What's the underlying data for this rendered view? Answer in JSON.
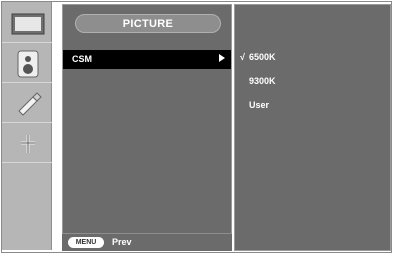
{
  "header": {
    "title": "PICTURE"
  },
  "menu": {
    "items": [
      {
        "label": "CSM"
      }
    ]
  },
  "submenu": {
    "options": [
      {
        "label": "6500K",
        "selected": true
      },
      {
        "label": "9300K",
        "selected": false
      },
      {
        "label": "User",
        "selected": false
      }
    ],
    "check_mark": "√"
  },
  "footer": {
    "menu_badge": "MENU",
    "prev_label": "Prev"
  },
  "sidebar": {
    "icons": [
      "picture-icon",
      "audio-speaker-icon",
      "tracking-tool-icon",
      "setup-icon"
    ]
  }
}
